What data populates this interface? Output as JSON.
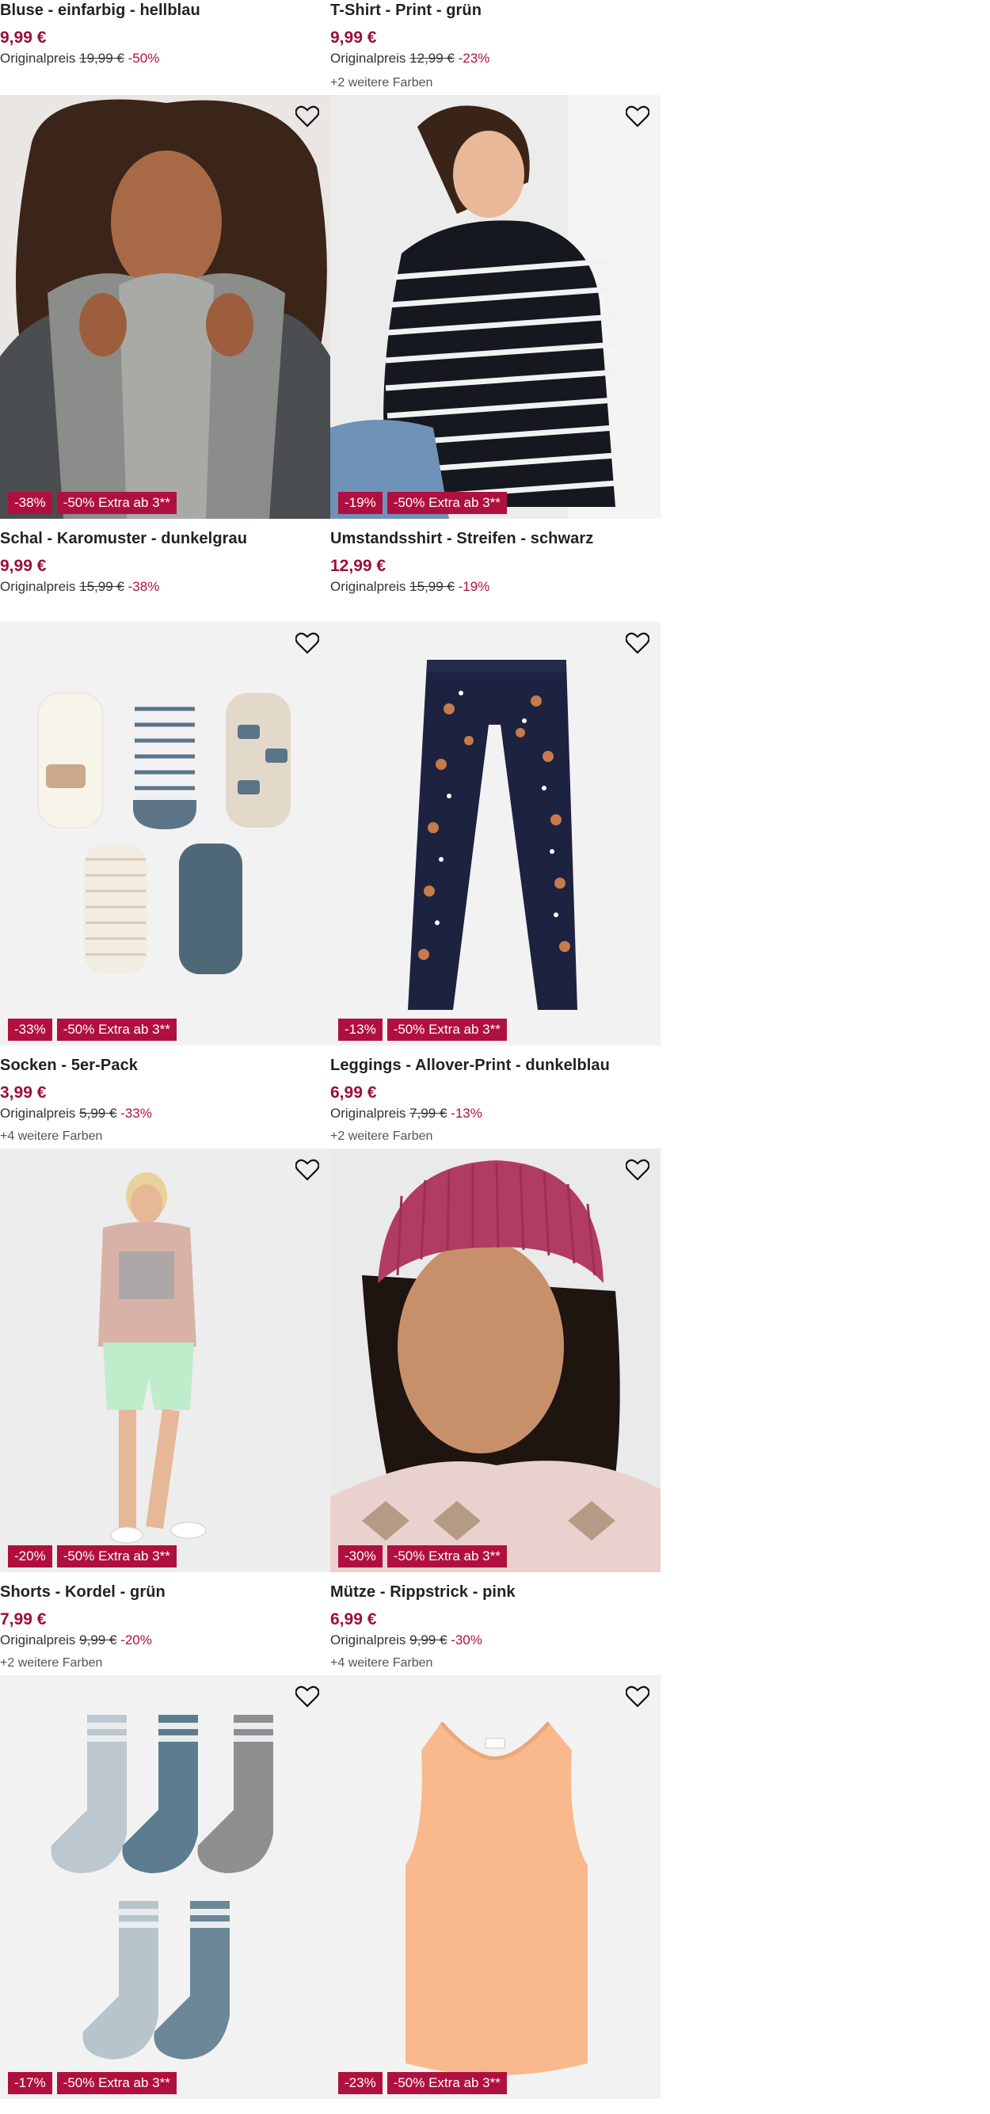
{
  "products": [
    {
      "name": "Bluse - einfarbig - hellblau",
      "price": "9,99 €",
      "orig_label": "Originalpreis",
      "orig_price": "19,99 €",
      "discount": "-50%",
      "colors": ""
    },
    {
      "name": "T-Shirt - Print - grün",
      "price": "9,99 €",
      "orig_label": "Originalpreis",
      "orig_price": "12,99 €",
      "discount": "-23%",
      "colors": "+2 weitere Farben"
    },
    {
      "name": "Schal - Karomuster - dunkelgrau",
      "price": "9,99 €",
      "orig_label": "Originalpreis",
      "orig_price": "15,99 €",
      "discount": "-38%",
      "colors": "",
      "badge": "-38%",
      "extra": "-50% Extra ab 3**",
      "image": "scarf-model"
    },
    {
      "name": "Umstandsshirt - Streifen - schwarz",
      "price": "12,99 €",
      "orig_label": "Originalpreis",
      "orig_price": "15,99 €",
      "discount": "-19%",
      "colors": "",
      "badge": "-19%",
      "extra": "-50% Extra ab 3**",
      "image": "striped-maternity-shirt"
    },
    {
      "name": "Socken - 5er-Pack",
      "price": "3,99 €",
      "orig_label": "Originalpreis",
      "orig_price": "5,99 €",
      "discount": "-33%",
      "colors": "+4 weitere Farben",
      "badge": "-33%",
      "extra": "-50% Extra ab 3**",
      "image": "baby-socks"
    },
    {
      "name": "Leggings - Allover-Print - dunkelblau",
      "price": "6,99 €",
      "orig_label": "Originalpreis",
      "orig_price": "7,99 €",
      "discount": "-13%",
      "colors": "+2 weitere Farben",
      "badge": "-13%",
      "extra": "-50% Extra ab 3**",
      "image": "printed-leggings"
    },
    {
      "name": "Shorts - Kordel - grün",
      "price": "7,99 €",
      "orig_label": "Originalpreis",
      "orig_price": "9,99 €",
      "discount": "-20%",
      "colors": "+2 weitere Farben",
      "badge": "-20%",
      "extra": "-50% Extra ab 3**",
      "image": "shorts-model"
    },
    {
      "name": "Mütze - Rippstrick - pink",
      "price": "6,99 €",
      "orig_label": "Originalpreis",
      "orig_price": "9,99 €",
      "discount": "-30%",
      "colors": "+4 weitere Farben",
      "badge": "-30%",
      "extra": "-50% Extra ab 3**",
      "image": "pink-beanie-model"
    },
    {
      "badge": "-17%",
      "extra": "-50% Extra ab 3**",
      "image": "sport-socks"
    },
    {
      "badge": "-23%",
      "extra": "-50% Extra ab 3**",
      "image": "peach-tank-top"
    }
  ],
  "icons": {
    "wishlist": "heart-icon"
  },
  "colors": {
    "accent": "#9b0e3c",
    "badge": "#b0103f",
    "image_bg": "#f2f2f2"
  }
}
